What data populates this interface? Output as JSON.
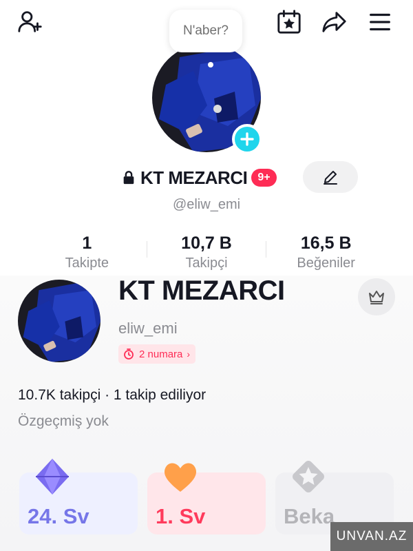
{
  "header": {
    "speech_bubble": "N'aber?",
    "icons": [
      "add-user-icon",
      "calendar-star-icon",
      "share-icon",
      "menu-icon"
    ]
  },
  "profile": {
    "display_name": "KT MEZARCI",
    "notification_badge": "9+",
    "handle": "@eliw_emi"
  },
  "stats": [
    {
      "value": "1",
      "label": "Takipte"
    },
    {
      "value": "10,7 B",
      "label": "Takipçi"
    },
    {
      "value": "16,5 B",
      "label": "Beğeniler"
    }
  ],
  "card": {
    "name": "KT MEZARCI",
    "handle": "eliw_emi",
    "rank": "2 numara",
    "follow_summary": "10.7K takipçi · 1 takip ediliyor",
    "bio": "Özgeçmiş yok"
  },
  "levels": [
    {
      "label": "24. Sv"
    },
    {
      "label": "1. Sv"
    },
    {
      "label": "Beka"
    }
  ],
  "watermark": "UNVAN.AZ",
  "colors": {
    "accent": "#fe2c55",
    "plus_badge": "#20d5ec",
    "level_purple": "#7676e8"
  }
}
